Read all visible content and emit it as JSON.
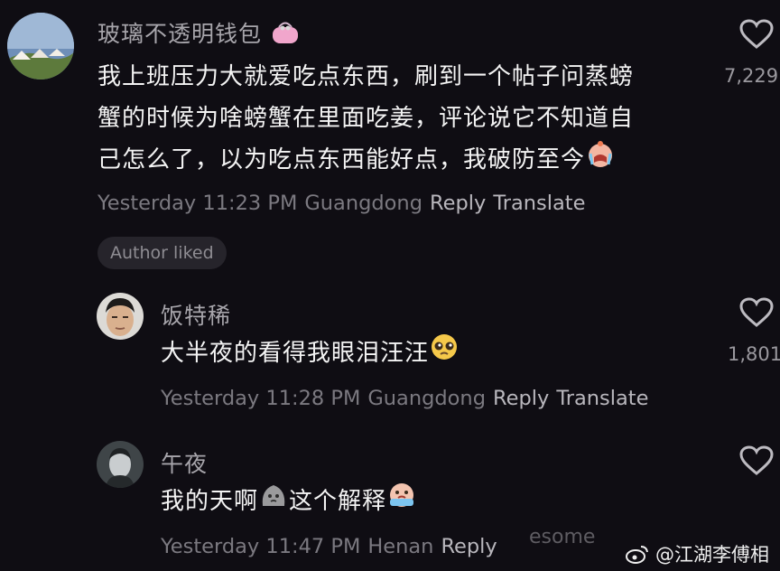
{
  "comments": [
    {
      "username": "玻璃不透明钱包",
      "lines": [
        "我上班压力大就爱吃点东西，刷到一个帖子问蒸螃",
        "蟹的时候为啥螃蟹在里面吃姜，评论说它不知道自",
        "己怎么了，以为吃点东西能好点，我破防至今"
      ],
      "time": "Yesterday 11:23 PM",
      "location": "Guangdong",
      "reply_label": "Reply",
      "translate_label": "Translate",
      "like_count": "7,229",
      "author_liked": "Author liked",
      "name_emoji": "purse-emoji",
      "end_emoji": "crying-face-emoji"
    },
    {
      "username": "饭特稀",
      "lines": [
        "大半夜的看得我眼泪汪汪"
      ],
      "time": "Yesterday 11:28 PM",
      "location": "Guangdong",
      "reply_label": "Reply",
      "translate_label": "Translate",
      "like_count": "1,801",
      "end_emoji": "pleading-face-emoji"
    },
    {
      "username": "午夜",
      "line_part1": "我的天啊",
      "line_part2": "这个解释",
      "time": "Yesterday 11:47 PM",
      "location": "Henan",
      "reply_label": "Reply",
      "mid_emoji": "sad-blob-emoji",
      "end_emoji": "sobbing-face-emoji"
    }
  ],
  "overlay_text": "esome",
  "watermark": {
    "icon": "weibo-logo",
    "text": "@江湖李傅相"
  },
  "colors": {
    "background": "#0f0d13",
    "text": "#f4f4f4",
    "muted": "#7b7980",
    "action": "#b9b7bd"
  }
}
